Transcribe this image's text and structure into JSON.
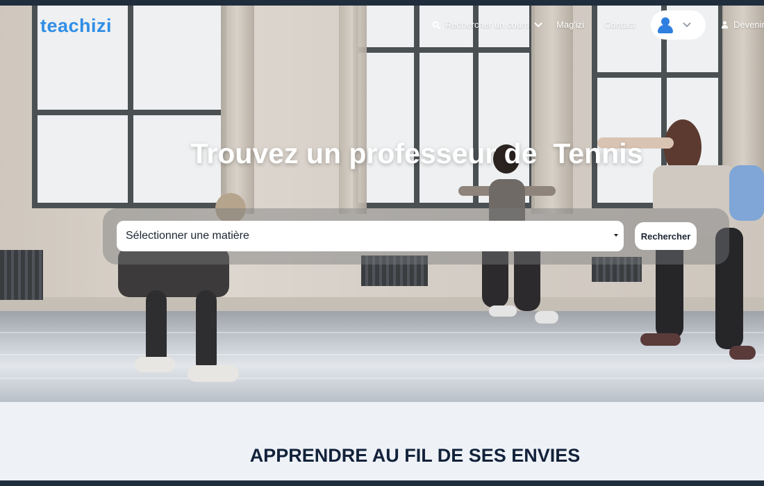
{
  "brand": {
    "logo_text": "teachizi",
    "logo_color": "#2f8ee6"
  },
  "nav": {
    "search_label": "Rechercher un cours",
    "magazine_label": "Mag'izi",
    "contact_label": "Contact",
    "become_label": "Devenir",
    "account_icon": "user-icon"
  },
  "hero": {
    "title": "Trouvez un professeur de  Tennis",
    "select_placeholder": "Sélectionner une matière",
    "search_button": "Rechercher"
  },
  "section": {
    "title": "APPRENDRE AU FIL DE SES ENVIES"
  },
  "colors": {
    "accent": "#2f8ee6",
    "heading": "#13223a",
    "section_bg": "#eef2f7"
  }
}
